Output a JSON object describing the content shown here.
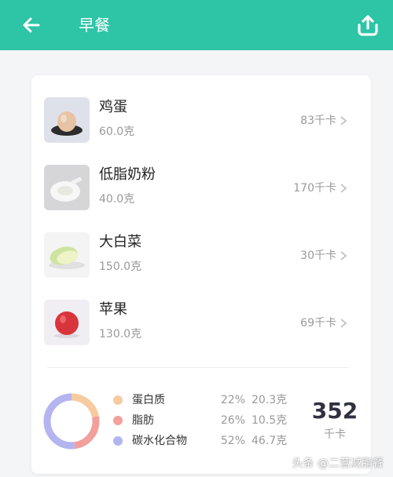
{
  "header": {
    "title": "早餐",
    "back_icon": "arrow-left-icon",
    "share_icon": "share-upload-icon",
    "color": "#2ec4a6"
  },
  "foods": [
    {
      "name": "鸡蛋",
      "weight": "60.0克",
      "kcal": "83千卡",
      "icon": "egg-icon"
    },
    {
      "name": "低脂奶粉",
      "weight": "40.0克",
      "kcal": "170千卡",
      "icon": "milk-powder-icon"
    },
    {
      "name": "大白菜",
      "weight": "150.0克",
      "kcal": "30千卡",
      "icon": "cabbage-icon"
    },
    {
      "name": "苹果",
      "weight": "130.0克",
      "kcal": "69千卡",
      "icon": "apple-icon"
    }
  ],
  "nutrition": {
    "items": [
      {
        "name": "蛋白质",
        "pct": "22%",
        "grams": "20.3克",
        "color": "#f7caa0"
      },
      {
        "name": "脂肪",
        "pct": "26%",
        "grams": "10.5克",
        "color": "#f2a09c"
      },
      {
        "name": "碳水化合物",
        "pct": "52%",
        "grams": "46.7克",
        "color": "#b4b4f0"
      }
    ],
    "total": "352",
    "unit": "千卡"
  },
  "watermark": "头条 @二营减脂餐"
}
